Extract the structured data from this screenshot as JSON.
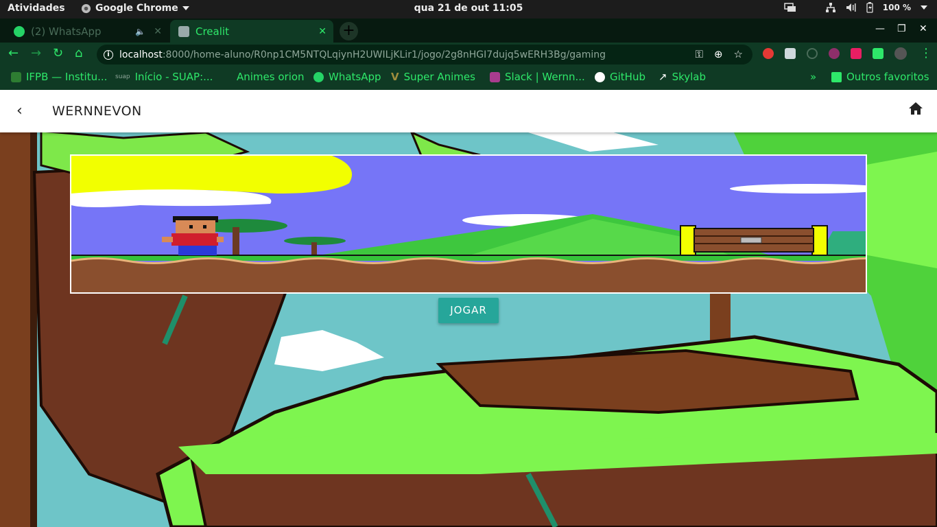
{
  "topbar": {
    "activities": "Atividades",
    "app_name": "Google Chrome",
    "clock": "qua 21 de out  11:05",
    "battery": "100 %"
  },
  "tabs": [
    {
      "title": "(2) WhatsApp",
      "favicon": "whatsapp-icon",
      "active": false
    },
    {
      "title": "Crealit",
      "favicon": "page-icon",
      "active": true
    }
  ],
  "toolbar": {
    "url_host": "localhost",
    "url_path": ":8000/home-aluno/R0np1CM5NTQLqiynH2UWILjKLir1/jogo/2g8nHGI7dujq5wERH3Bg/gaming"
  },
  "bookmarks": [
    {
      "label": "IFPB — Institu...",
      "icon": "ifpb-icon"
    },
    {
      "label": "Início - SUAP:...",
      "icon": "suap-icon"
    },
    {
      "label": "Animes orion",
      "icon": ""
    },
    {
      "label": "WhatsApp",
      "icon": "whatsapp-icon"
    },
    {
      "label": "Super Animes",
      "icon": "super-animes-icon"
    },
    {
      "label": "Slack | Wernn...",
      "icon": "slack-icon"
    },
    {
      "label": "GitHub",
      "icon": "github-icon"
    },
    {
      "label": "Skylab",
      "icon": "skylab-icon"
    },
    {
      "label": "Outros favoritos",
      "icon": "folder-icon"
    }
  ],
  "page": {
    "title": "WERNNEVON",
    "play_button": "JOGAR"
  },
  "colors": {
    "theme_green": "#2ee86a",
    "toolbar_bg": "#0f3a24",
    "button_teal": "#26a69a"
  }
}
